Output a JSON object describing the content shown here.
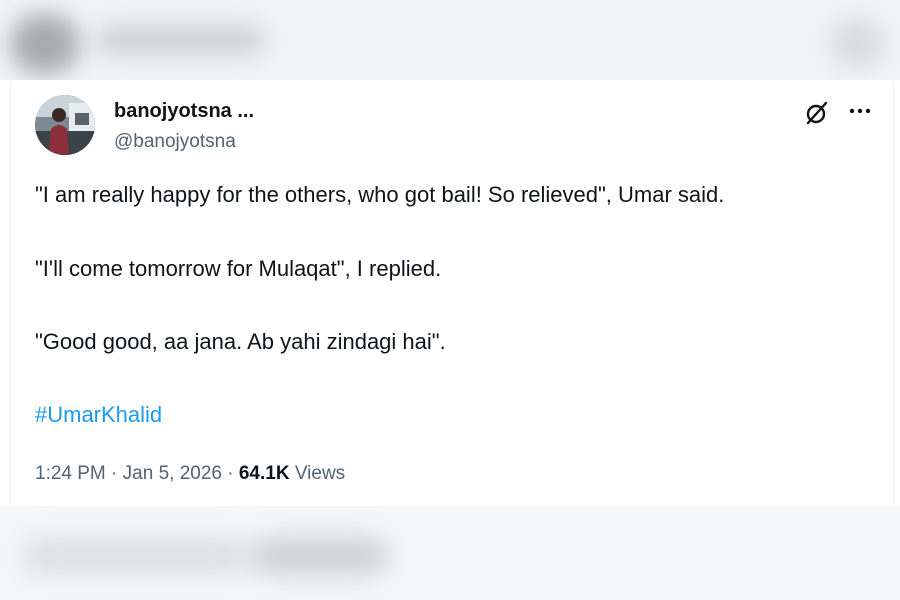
{
  "author": {
    "display_name": "banojyotsna ...",
    "handle": "@banojyotsna"
  },
  "icons": {
    "grok": "grok-icon",
    "more": "more-options-icon"
  },
  "tweet": {
    "paragraphs": [
      "\"I am really happy for the others, who got bail! So relieved\", Umar said.",
      "\"I'll come tomorrow for Mulaqat\", I replied.",
      "\"Good good, aa jana. Ab yahi zindagi hai\"."
    ],
    "hashtag": "#UmarKhalid"
  },
  "meta": {
    "time": "1:24 PM",
    "separator": "·",
    "date": "Jan 5, 2026",
    "views_count": "64.1K",
    "views_label": "Views"
  },
  "colors": {
    "text": "#0f1419",
    "secondary": "#536471",
    "link": "#1d9bf0"
  }
}
